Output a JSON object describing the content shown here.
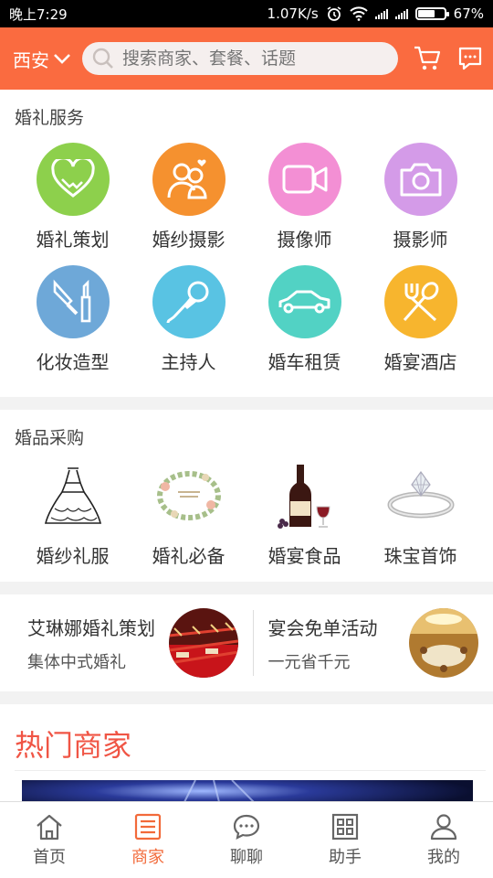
{
  "status_bar": {
    "time": "晚上7:29",
    "speed": "1.07K/s",
    "battery_pct": "67%",
    "battery_level": 0.67
  },
  "header": {
    "city": "西安",
    "search_placeholder": "搜索商家、套餐、话题"
  },
  "services": {
    "title": "婚礼服务",
    "items": [
      {
        "label": "婚礼策划",
        "icon": "handshake-heart-icon",
        "color": "#8dd04c"
      },
      {
        "label": "婚纱摄影",
        "icon": "couple-icon",
        "color": "#f5912f"
      },
      {
        "label": "摄像师",
        "icon": "video-camera-icon",
        "color": "#f38fd4"
      },
      {
        "label": "摄影师",
        "icon": "camera-icon",
        "color": "#d49be8"
      },
      {
        "label": "化妆造型",
        "icon": "makeup-brush-icon",
        "color": "#6ea8d8"
      },
      {
        "label": "主持人",
        "icon": "microphone-icon",
        "color": "#59c3e3"
      },
      {
        "label": "婚车租赁",
        "icon": "car-icon",
        "color": "#52d2c4"
      },
      {
        "label": "婚宴酒店",
        "icon": "fork-spoon-icon",
        "color": "#f7b52e"
      }
    ]
  },
  "products": {
    "title": "婚品采购",
    "items": [
      {
        "label": "婚纱礼服",
        "icon": "wedding-dress-icon"
      },
      {
        "label": "婚礼必备",
        "icon": "wedding-wreath-icon"
      },
      {
        "label": "婚宴食品",
        "icon": "wine-bottle-icon"
      },
      {
        "label": "珠宝首饰",
        "icon": "diamond-ring-icon"
      }
    ]
  },
  "promos": [
    {
      "title": "艾琳娜婚礼策划",
      "subtitle": "集体中式婚礼"
    },
    {
      "title": "宴会免单活动",
      "subtitle": "一元省千元"
    }
  ],
  "hot": {
    "title": "热门商家"
  },
  "nav": [
    {
      "label": "首页",
      "icon": "home-icon"
    },
    {
      "label": "商家",
      "icon": "list-icon",
      "active": true
    },
    {
      "label": "聊聊",
      "icon": "chat-icon"
    },
    {
      "label": "助手",
      "icon": "grid-icon"
    },
    {
      "label": "我的",
      "icon": "user-icon"
    }
  ],
  "colors": {
    "brand": "#fa6b40",
    "active": "#f26a3a",
    "hot_title": "#f05545"
  }
}
